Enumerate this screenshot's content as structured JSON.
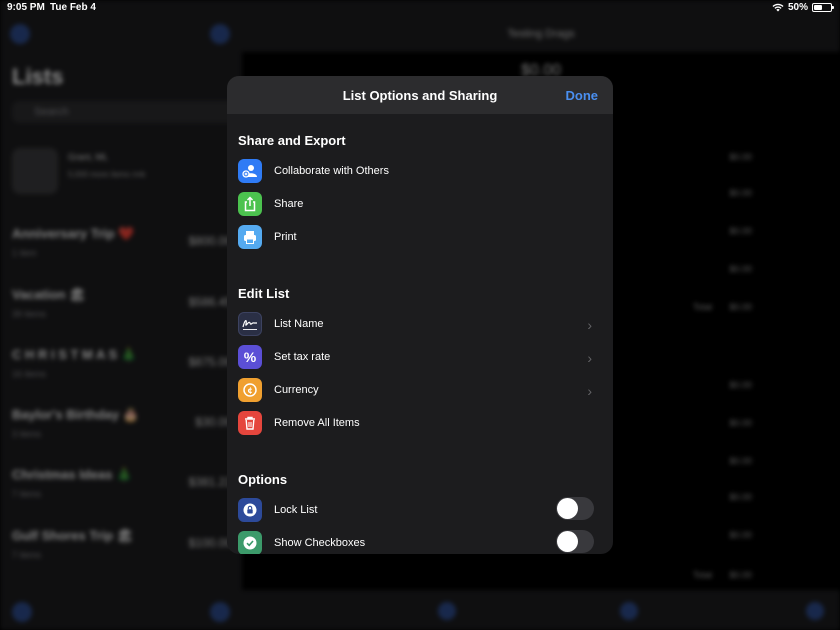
{
  "status_bar": {
    "time": "9:05 PM",
    "date": "Tue Feb 4",
    "battery": "50%"
  },
  "background": {
    "sidebar": {
      "title": "Lists",
      "search_placeholder": "Search",
      "profile_name": "Grant, ML",
      "profile_sub": "5,000 more items rmk",
      "lists": [
        {
          "name": "Anniversary Trip ❤️",
          "sub": "1 item",
          "amount": "$800.00"
        },
        {
          "name": "Vacation 🏖",
          "sub": "39 items",
          "amount": "$586.45"
        },
        {
          "name": "C H R I S T M A S 🎄",
          "sub": "16 items",
          "amount": "$875.00"
        },
        {
          "name": "Baylor's Birthday 🎂",
          "sub": "3 items",
          "amount": "$30.00"
        },
        {
          "name": "Christmas Ideas 🎄",
          "sub": "7 items",
          "amount": "$381.22"
        },
        {
          "name": "Gulf Shores Trip 🏖",
          "sub": "7 items",
          "amount": "$100.00"
        }
      ]
    },
    "detail": {
      "title": "Testing Drags",
      "amount": "$0.00",
      "prices": [
        "$0.00",
        "$0.00",
        "$0.00",
        "$0.00",
        "$0.00",
        "$0.00",
        "$0.00",
        "$0.00",
        "$0.00",
        "$0.00",
        "$0.00"
      ],
      "total_label": "Total"
    }
  },
  "modal": {
    "title": "List Options and Sharing",
    "done_label": "Done",
    "sections": {
      "share": {
        "title": "Share and Export",
        "items": [
          {
            "label": "Collaborate with Others",
            "icon": "people-icon",
            "color": "#2f7bf5"
          },
          {
            "label": "Share",
            "icon": "share-icon",
            "color": "#4cc24f"
          },
          {
            "label": "Print",
            "icon": "printer-icon",
            "color": "#55aaf0"
          }
        ]
      },
      "edit": {
        "title": "Edit List",
        "items": [
          {
            "label": "List Name",
            "icon": "signature-icon",
            "color": "#2a2f45"
          },
          {
            "label": "Set tax rate",
            "icon": "percent-icon",
            "color": "#5b4fd6"
          },
          {
            "label": "Currency",
            "icon": "coin-icon",
            "color": "#f0a030"
          },
          {
            "label": "Remove All Items",
            "icon": "trash-icon",
            "color": "#e5463d"
          }
        ]
      },
      "options": {
        "title": "Options",
        "items": [
          {
            "label": "Lock List",
            "icon": "lock-icon",
            "color": "#2d4a9a",
            "toggle": false
          },
          {
            "label": "Show Checkboxes",
            "icon": "checkmark-icon",
            "color": "#3c9a6a",
            "toggle": false
          }
        ]
      }
    }
  }
}
